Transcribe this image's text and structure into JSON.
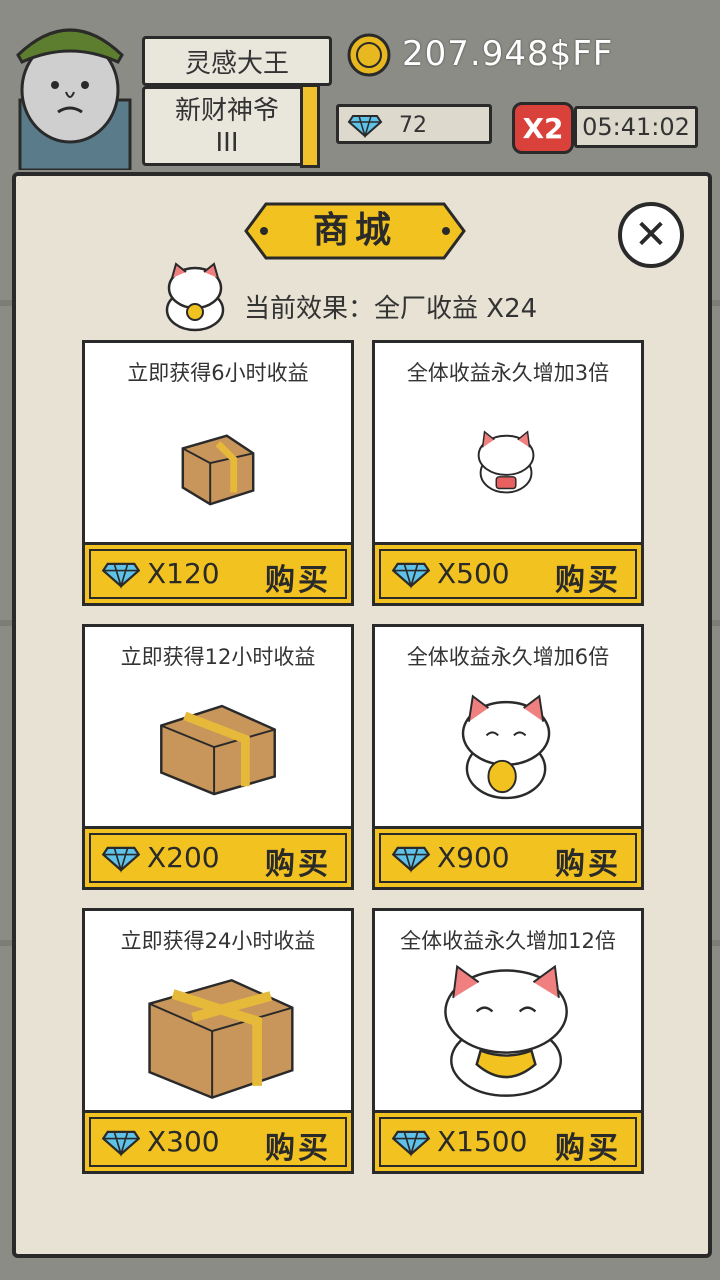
{
  "player": {
    "name": "灵感大王",
    "title_line1": "新财神爷",
    "title_line2": "III"
  },
  "currency": {
    "coins": "207.948$FF",
    "gems": "72",
    "boost": "X2",
    "timer": "05:41:02"
  },
  "shop": {
    "title": "商城",
    "current_effect": "当前效果：全厂收益 X24",
    "close_label": "✕",
    "buy_label": "购买",
    "items": [
      {
        "title": "立即获得6小时收益",
        "price": "X120",
        "icon": "box-small-icon"
      },
      {
        "title": "全体收益永久增加3倍",
        "price": "X500",
        "icon": "lucky-cat-small-icon"
      },
      {
        "title": "立即获得12小时收益",
        "price": "X200",
        "icon": "box-medium-icon"
      },
      {
        "title": "全体收益永久增加6倍",
        "price": "X900",
        "icon": "lucky-cat-medium-icon"
      },
      {
        "title": "立即获得24小时收益",
        "price": "X300",
        "icon": "box-large-icon"
      },
      {
        "title": "全体收益永久增加12倍",
        "price": "X1500",
        "icon": "lucky-cat-large-icon"
      }
    ]
  },
  "colors": {
    "accent_yellow": "#f2c320",
    "gem_blue": "#3fa9d6",
    "boost_red": "#d9413a",
    "panel": "#e7e2d4"
  }
}
